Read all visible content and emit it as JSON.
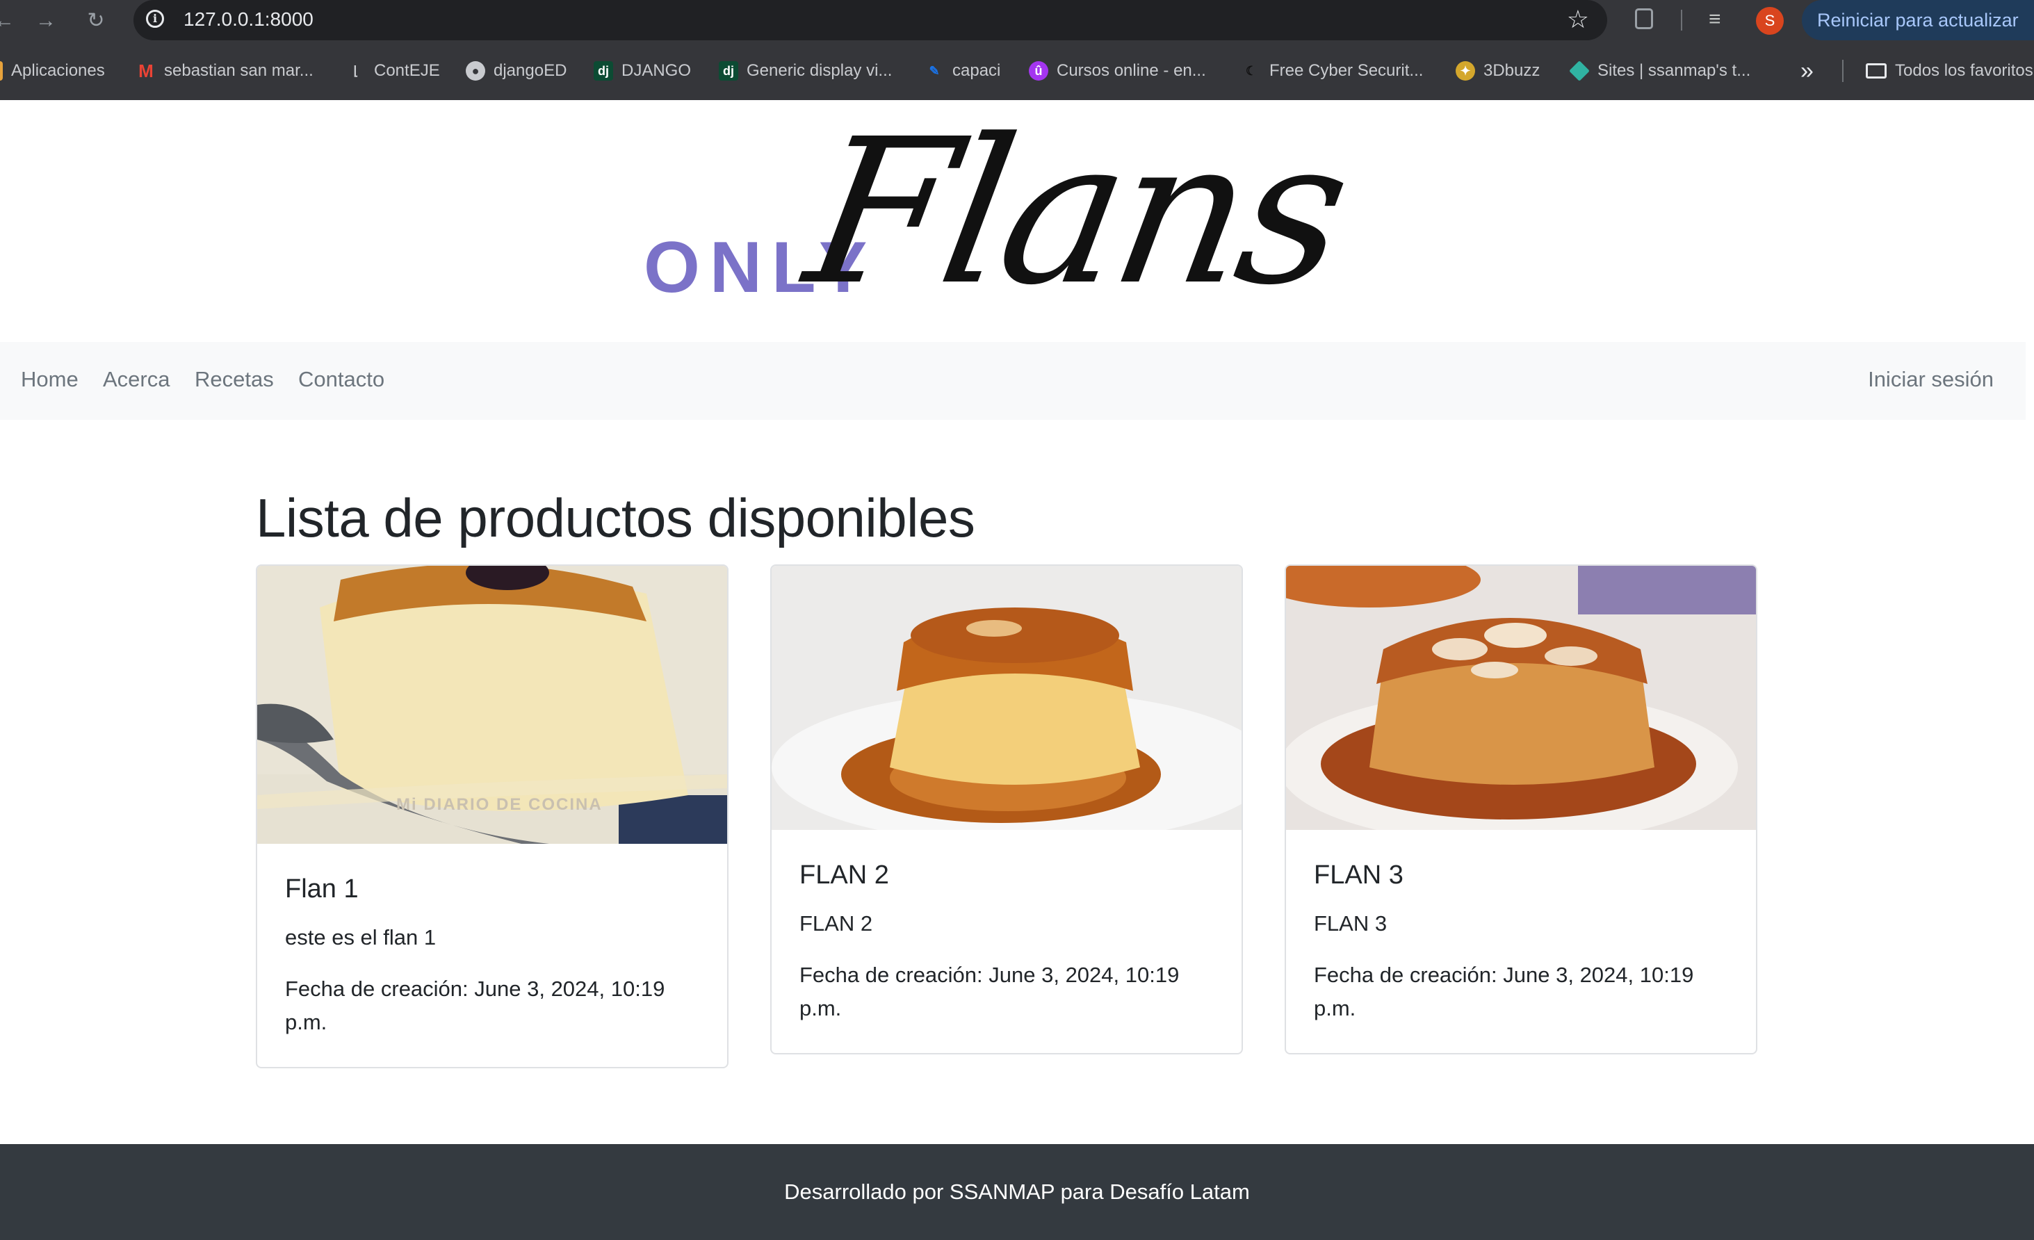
{
  "browser": {
    "url": "127.0.0.1:8000",
    "update_button": "Reiniciar para actualizar",
    "avatar_letter": "S",
    "bookmarks": [
      {
        "label": "Aplicaciones",
        "icon": "apps-grid-icon"
      },
      {
        "label": "sebastian san mar...",
        "icon": "gmail-icon"
      },
      {
        "label": "ContEJE",
        "icon": "page-icon"
      },
      {
        "label": "djangoED",
        "icon": "globe-icon"
      },
      {
        "label": "DJANGO",
        "icon": "django-icon"
      },
      {
        "label": "Generic display vi...",
        "icon": "django-icon"
      },
      {
        "label": "capaci",
        "icon": "edit-icon"
      },
      {
        "label": "Cursos online - en...",
        "icon": "udemy-icon"
      },
      {
        "label": "Free Cyber Securit...",
        "icon": "moon-icon"
      },
      {
        "label": "3Dbuzz",
        "icon": "3dbuzz-icon"
      },
      {
        "label": "Sites | ssanmap's t...",
        "icon": "diamond-icon"
      }
    ],
    "all_bookmarks": "Todos los favoritos"
  },
  "logo": {
    "only": "ONLY",
    "flans": "Flans"
  },
  "nav": {
    "links": [
      "Home",
      "Acerca",
      "Recetas",
      "Contacto"
    ],
    "login": "Iniciar sesión"
  },
  "main": {
    "title": "Lista de productos disponibles",
    "products": [
      {
        "name": "Flan 1",
        "description": "este es el flan 1",
        "date": "Fecha de creación: June 3, 2024, 10:19 p.m.",
        "watermark": "Mi DIARIO DE COCINA"
      },
      {
        "name": "FLAN 2",
        "description": "FLAN 2",
        "date": "Fecha de creación: June 3, 2024, 10:19 p.m."
      },
      {
        "name": "FLAN 3",
        "description": "FLAN 3",
        "date": "Fecha de creación: June 3, 2024, 10:19 p.m."
      }
    ]
  },
  "footer": {
    "text": "Desarrollado por SSANMAP para Desafío Latam"
  }
}
